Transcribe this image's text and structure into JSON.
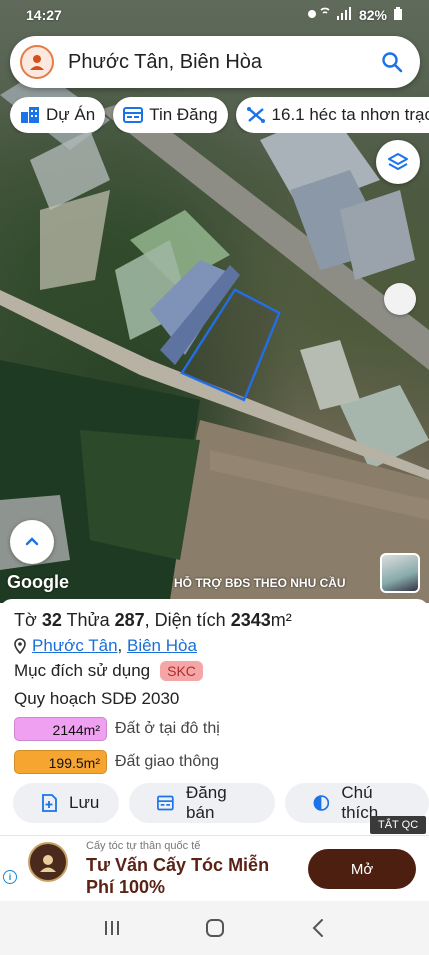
{
  "status_bar": {
    "time": "14:27",
    "battery": "82%"
  },
  "search": {
    "query": "Phước Tân, Biên Hòa"
  },
  "chips": [
    {
      "label": "Dự Án",
      "icon": "building-icon"
    },
    {
      "label": "Tin Đăng",
      "icon": "listing-icon"
    },
    {
      "label": "16.1 héc ta nhơn trạch",
      "icon": "ruler-icon"
    }
  ],
  "map": {
    "google_label": "Google",
    "promo_text": "HỖ TRỢ BĐS  THEO NHU CẦU",
    "parcel_outline_color": "#1e73ff"
  },
  "parcel": {
    "sheet_prefix": "Tờ ",
    "sheet_no": "32",
    "lot_prefix": " Thửa ",
    "lot_no": "287",
    "area_prefix": ", Diện tích ",
    "area_value": "2343",
    "area_unit": "m²",
    "ward": "Phước Tân",
    "separator": ", ",
    "city": "Biên Hòa",
    "usage_label": "Mục đích sử dụng",
    "usage_code": "SKC",
    "plan_title": "Quy hoạch SDĐ 2030",
    "legend": [
      {
        "value": "2144m²",
        "label": "Đất ở tại đô thị",
        "color": "#f0a0f0"
      },
      {
        "value": "199.5m²",
        "label": "Đất giao thông",
        "color": "#f6a630"
      }
    ]
  },
  "actions": [
    {
      "label": "Lưu",
      "icon": "save-icon"
    },
    {
      "label": "Đăng bán",
      "icon": "listing-icon"
    },
    {
      "label": "Chú thích",
      "icon": "legend-icon"
    }
  ],
  "close_ad_label": "TẮT QC",
  "ad": {
    "subtitle": "Cấy tóc tự thân quốc tế",
    "headline": "Tư Vấn Cấy Tóc Miễn Phí 100%",
    "button": "Mở",
    "brand_color": "#4d1f10"
  }
}
